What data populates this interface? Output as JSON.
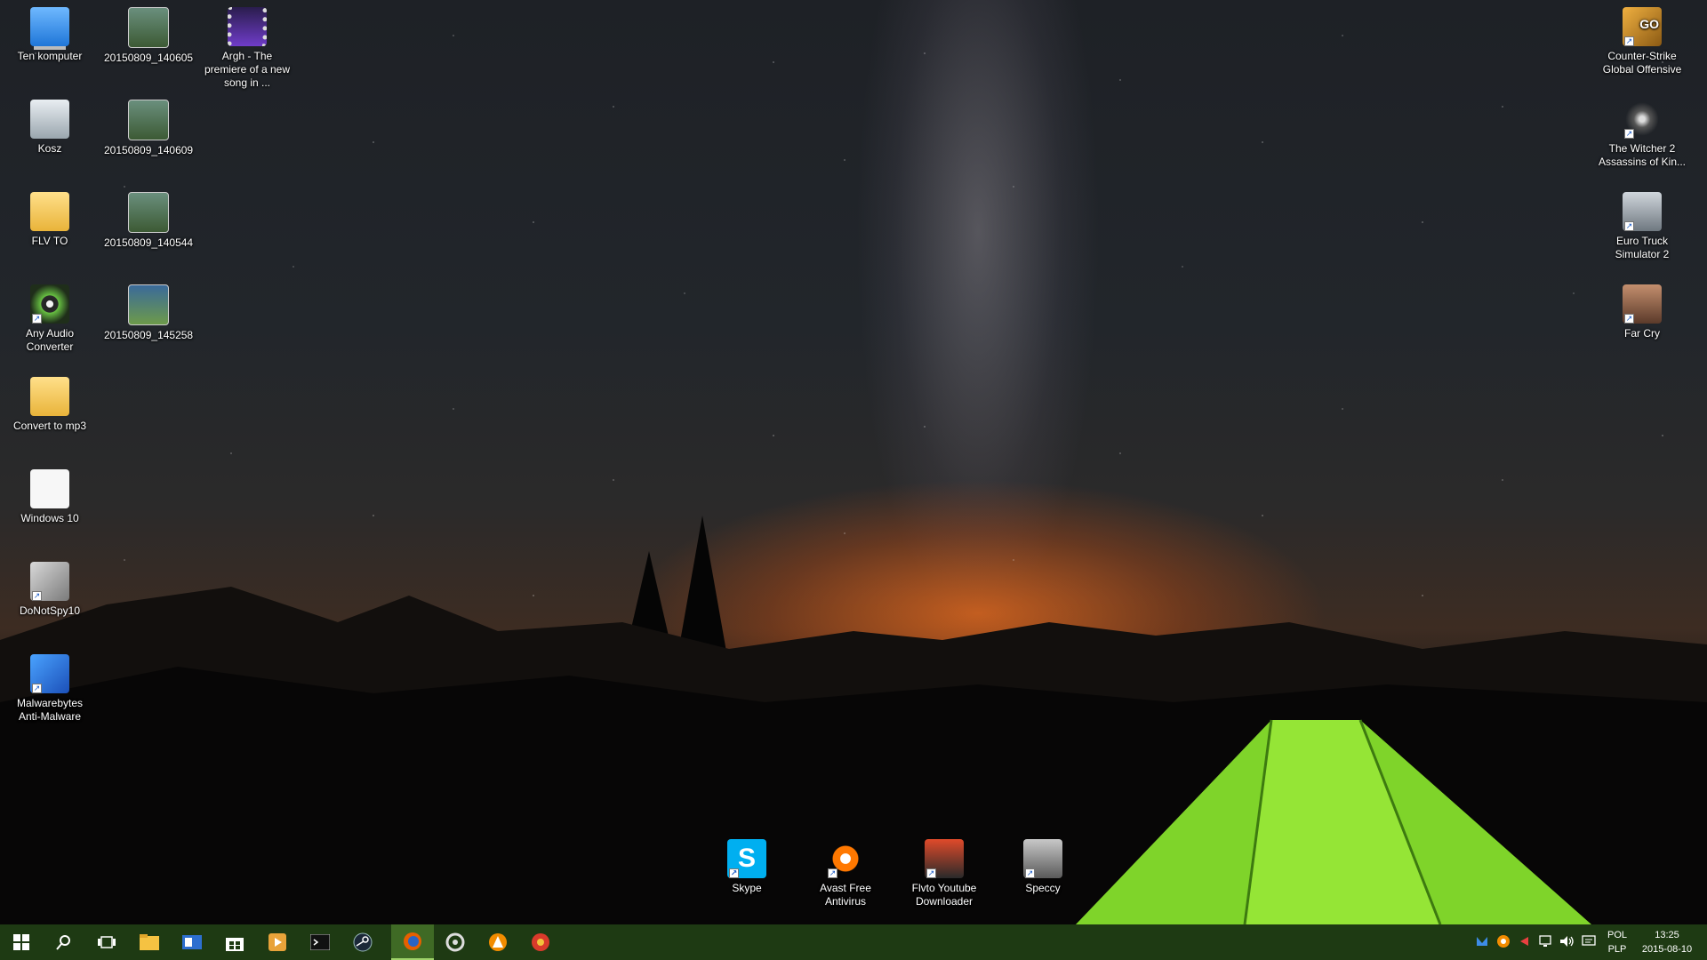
{
  "desktop_icons": {
    "this_pc": "Ten komputer",
    "recycle_bin": "Kosz",
    "flv_to": "FLV TO",
    "any_audio_converter": "Any Audio Converter",
    "convert_to_mp3": "Convert to mp3",
    "windows10": "Windows 10",
    "donotspy10": "DoNotSpy10",
    "malwarebytes": "Malwarebytes Anti-Malware",
    "photo1": "20150809_140605",
    "photo2": "20150809_140609",
    "photo3": "20150809_140544",
    "photo4": "20150809_145258",
    "video1": "Argh - The premiere of a new song in ...",
    "csgo": "Counter-Strike Global Offensive",
    "witcher2": "The Witcher 2 Assassins of Kin...",
    "euro_truck": "Euro Truck Simulator 2",
    "far_cry": "Far Cry",
    "skype": "Skype",
    "avast": "Avast Free Antivirus",
    "flvto_downloader": "Flvto Youtube Downloader",
    "speccy": "Speccy"
  },
  "icon_glyphs": {
    "skype_letter": "S",
    "csgo_text": "GO"
  },
  "taskbar": {
    "apps": [
      "start-icon",
      "search-icon",
      "task-view-icon",
      "file-explorer-icon",
      "outlook-icon",
      "store-icon",
      "media-player-icon",
      "cmd-icon",
      "steam-icon",
      "firefox-icon",
      "origin-icon",
      "avast-icon",
      "chrome-remote-icon"
    ],
    "active_app": "firefox-icon",
    "tray": {
      "language_line1": "POL",
      "language_line2": "PLP",
      "time": "13:25",
      "date": "2015-08-10"
    }
  },
  "colors": {
    "taskbar_bg": "#1e3a13",
    "taskbar_active": "#3f6a25",
    "skype_blue": "#00aff0",
    "avast_orange": "#ff7800"
  }
}
